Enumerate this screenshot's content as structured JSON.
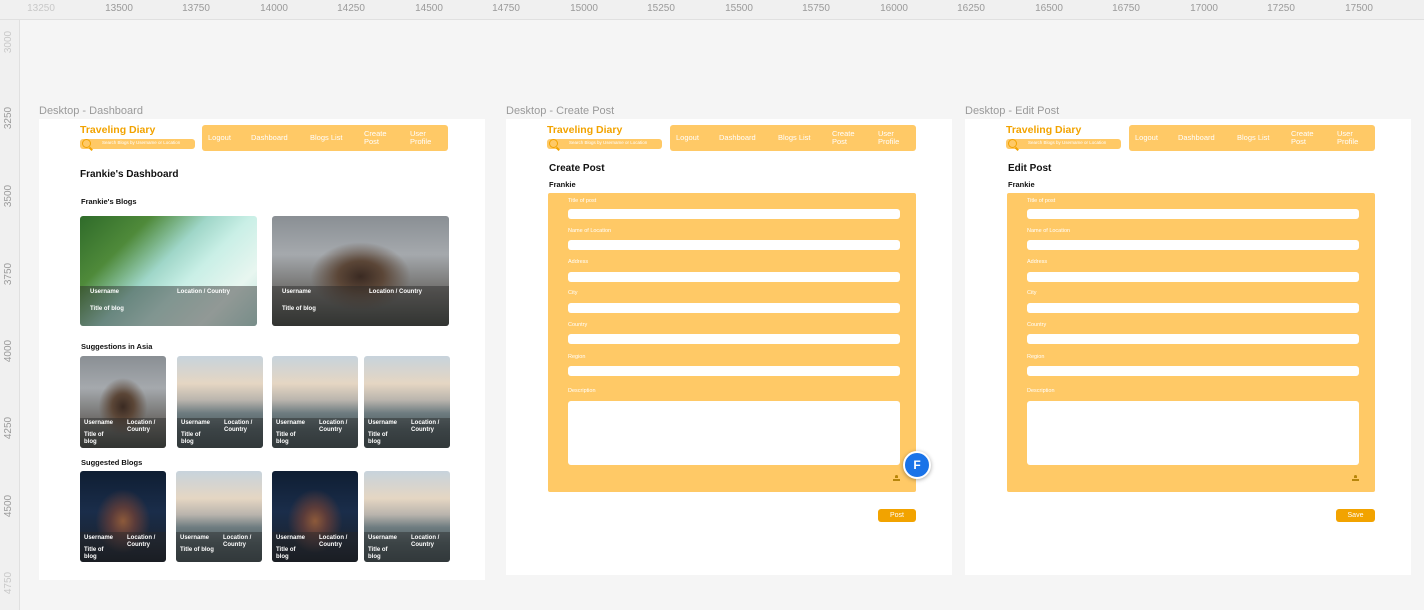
{
  "ruler": {
    "top_ticks": [
      "13250",
      "13500",
      "13750",
      "14000",
      "14250",
      "14500",
      "14750",
      "15000",
      "15250",
      "15500",
      "15750",
      "16000",
      "16250",
      "16500",
      "16750",
      "17000",
      "17250",
      "17500"
    ],
    "left_ticks": [
      "3000",
      "3250",
      "3500",
      "3750",
      "4000",
      "4250",
      "4500",
      "4750"
    ]
  },
  "frames": {
    "dashboard": {
      "label": "Desktop - Dashboard"
    },
    "create": {
      "label": "Desktop - Create Post"
    },
    "edit": {
      "label": "Desktop - Edit Post"
    }
  },
  "header": {
    "brand": "Traveling Diary",
    "search_placeholder": "Search Blogs by Username or Location",
    "nav": [
      "Logout",
      "Dashboard",
      "Blogs List",
      "Create Post",
      "User Profile"
    ]
  },
  "dashboard": {
    "title": "Frankie's Dashboard",
    "my_blogs_title": "Frankie's Blogs",
    "suggestions_title": "Suggestions in Asia",
    "suggested_title": "Suggested Blogs",
    "card_username": "Username",
    "card_location": "Location / Country",
    "card_title": "Title of blog"
  },
  "create_post": {
    "title": "Create Post",
    "author": "Frankie",
    "fields": [
      "Title of post",
      "Name of Location",
      "Address",
      "City",
      "Country",
      "Region",
      "Description"
    ],
    "button": "Post"
  },
  "edit_post": {
    "title": "Edit Post",
    "author": "Frankie",
    "fields": [
      "Title of post",
      "Name of Location",
      "Address",
      "City",
      "Country",
      "Region",
      "Description"
    ],
    "button": "Save"
  },
  "collaborator": {
    "initial": "F"
  },
  "colors": {
    "brand": "#f2a300",
    "panel": "#ffc966",
    "avatar": "#1a73e8"
  },
  "icons": {
    "search": "search-icon",
    "upload": "upload-icon"
  }
}
